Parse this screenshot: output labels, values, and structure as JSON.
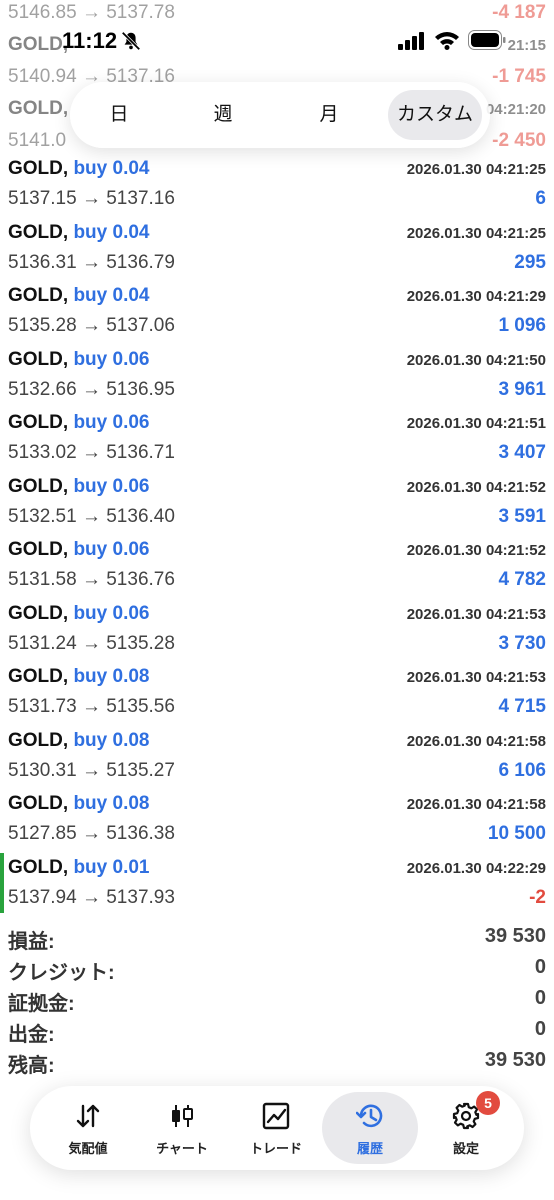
{
  "status_bar": {
    "time": "11:12"
  },
  "ghost_rows": [
    {
      "left": "5146.85 → 5137.78",
      "right": "-4 187",
      "right_color": "#e24b3f"
    },
    {
      "left": "GOLD,",
      "right": "21:15",
      "right_color": "#333333"
    },
    {
      "left": "5140.94 → 5137.16",
      "right": "-1 745",
      "right_color": "#e24b3f"
    },
    {
      "left": "GOLD,",
      "right": "04:21:20",
      "right_color": "#333333"
    },
    {
      "left": "5141.0",
      "right": "-2 450",
      "right_color": "#e24b3f"
    }
  ],
  "period_tabs": [
    {
      "label": "日",
      "active": false
    },
    {
      "label": "週",
      "active": false
    },
    {
      "label": "月",
      "active": false
    },
    {
      "label": "カスタム",
      "active": true
    }
  ],
  "deals": [
    {
      "symbol": "GOLD,",
      "side": "buy 0.04",
      "datetime": "2026.01.30 04:21:25",
      "prices": "5137.15 → 5137.16",
      "profit": "6",
      "negative": false
    },
    {
      "symbol": "GOLD,",
      "side": "buy 0.04",
      "datetime": "2026.01.30 04:21:25",
      "prices": "5136.31 → 5136.79",
      "profit": "295",
      "negative": false
    },
    {
      "symbol": "GOLD,",
      "side": "buy 0.04",
      "datetime": "2026.01.30 04:21:29",
      "prices": "5135.28 → 5137.06",
      "profit": "1 096",
      "negative": false
    },
    {
      "symbol": "GOLD,",
      "side": "buy 0.06",
      "datetime": "2026.01.30 04:21:50",
      "prices": "5132.66 → 5136.95",
      "profit": "3 961",
      "negative": false
    },
    {
      "symbol": "GOLD,",
      "side": "buy 0.06",
      "datetime": "2026.01.30 04:21:51",
      "prices": "5133.02 → 5136.71",
      "profit": "3 407",
      "negative": false
    },
    {
      "symbol": "GOLD,",
      "side": "buy 0.06",
      "datetime": "2026.01.30 04:21:52",
      "prices": "5132.51 → 5136.40",
      "profit": "3 591",
      "negative": false
    },
    {
      "symbol": "GOLD,",
      "side": "buy 0.06",
      "datetime": "2026.01.30 04:21:52",
      "prices": "5131.58 → 5136.76",
      "profit": "4 782",
      "negative": false
    },
    {
      "symbol": "GOLD,",
      "side": "buy 0.06",
      "datetime": "2026.01.30 04:21:53",
      "prices": "5131.24 → 5135.28",
      "profit": "3 730",
      "negative": false
    },
    {
      "symbol": "GOLD,",
      "side": "buy 0.08",
      "datetime": "2026.01.30 04:21:53",
      "prices": "5131.73 → 5135.56",
      "profit": "4 715",
      "negative": false
    },
    {
      "symbol": "GOLD,",
      "side": "buy 0.08",
      "datetime": "2026.01.30 04:21:58",
      "prices": "5130.31 → 5135.27",
      "profit": "6 106",
      "negative": false
    },
    {
      "symbol": "GOLD,",
      "side": "buy 0.08",
      "datetime": "2026.01.30 04:21:58",
      "prices": "5127.85 → 5136.38",
      "profit": "10 500",
      "negative": false
    },
    {
      "symbol": "GOLD,",
      "side": "buy 0.01",
      "datetime": "2026.01.30 04:22:29",
      "prices": "5137.94 → 5137.93",
      "profit": "-2",
      "negative": true,
      "marked": true
    }
  ],
  "summary": [
    {
      "label": "損益:",
      "value": "39 530"
    },
    {
      "label": "クレジット:",
      "value": "0"
    },
    {
      "label": "証拠金:",
      "value": "0"
    },
    {
      "label": "出金:",
      "value": "0"
    },
    {
      "label": "残高:",
      "value": "39 530"
    }
  ],
  "nav": [
    {
      "label": "気配値",
      "icon": "quotes-arrows-icon",
      "active": false
    },
    {
      "label": "チャート",
      "icon": "candlestick-icon",
      "active": false
    },
    {
      "label": "トレード",
      "icon": "trade-chart-icon",
      "active": false
    },
    {
      "label": "履歴",
      "icon": "history-clock-icon",
      "active": true
    },
    {
      "label": "設定",
      "icon": "gear-icon",
      "active": false,
      "badge": "5"
    }
  ],
  "colors": {
    "accent": "#2f6fe0",
    "negative": "#e24b3f",
    "marker": "#29a33d"
  }
}
